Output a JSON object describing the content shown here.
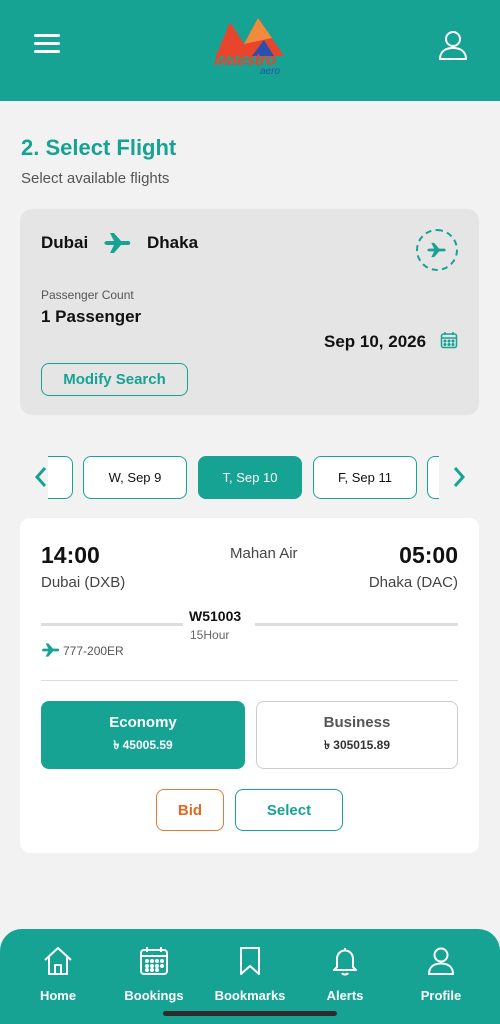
{
  "header": {
    "logo_text": "Maestro",
    "logo_sub": "aero"
  },
  "step": {
    "title": "2. Select Flight",
    "subtitle": "Select available flights"
  },
  "search": {
    "from": "Dubai",
    "to": "Dhaka",
    "passenger_label": "Passenger Count",
    "passenger_value": "1 Passenger",
    "date": "Sep 10, 2026",
    "modify_label": "Modify Search"
  },
  "date_strip": {
    "dates": [
      {
        "label": "W, Sep 9",
        "selected": false
      },
      {
        "label": "T, Sep 10",
        "selected": true
      },
      {
        "label": "F, Sep 11",
        "selected": false
      }
    ]
  },
  "flight": {
    "departure_time": "14:00",
    "arrival_time": "05:00",
    "airline": "Mahan Air",
    "departure_city": "Dubai (DXB)",
    "arrival_city": "Dhaka (DAC)",
    "flight_number": "W51003",
    "duration": "15Hour",
    "aircraft": "777-200ER",
    "fares": [
      {
        "class": "Economy",
        "price": "৳ 45005.59",
        "selected": true
      },
      {
        "class": "Business",
        "price": "৳ 305015.89",
        "selected": false
      }
    ],
    "bid_label": "Bid",
    "select_label": "Select"
  },
  "nav": {
    "items": [
      {
        "label": "Home",
        "icon": "home-icon"
      },
      {
        "label": "Bookings",
        "icon": "calendar-icon"
      },
      {
        "label": "Bookmarks",
        "icon": "bookmark-icon"
      },
      {
        "label": "Alerts",
        "icon": "bell-icon"
      },
      {
        "label": "Profile",
        "icon": "user-icon"
      }
    ]
  },
  "colors": {
    "primary": "#16a394",
    "accent_orange": "#e06a20",
    "background": "#f2f2f2"
  }
}
